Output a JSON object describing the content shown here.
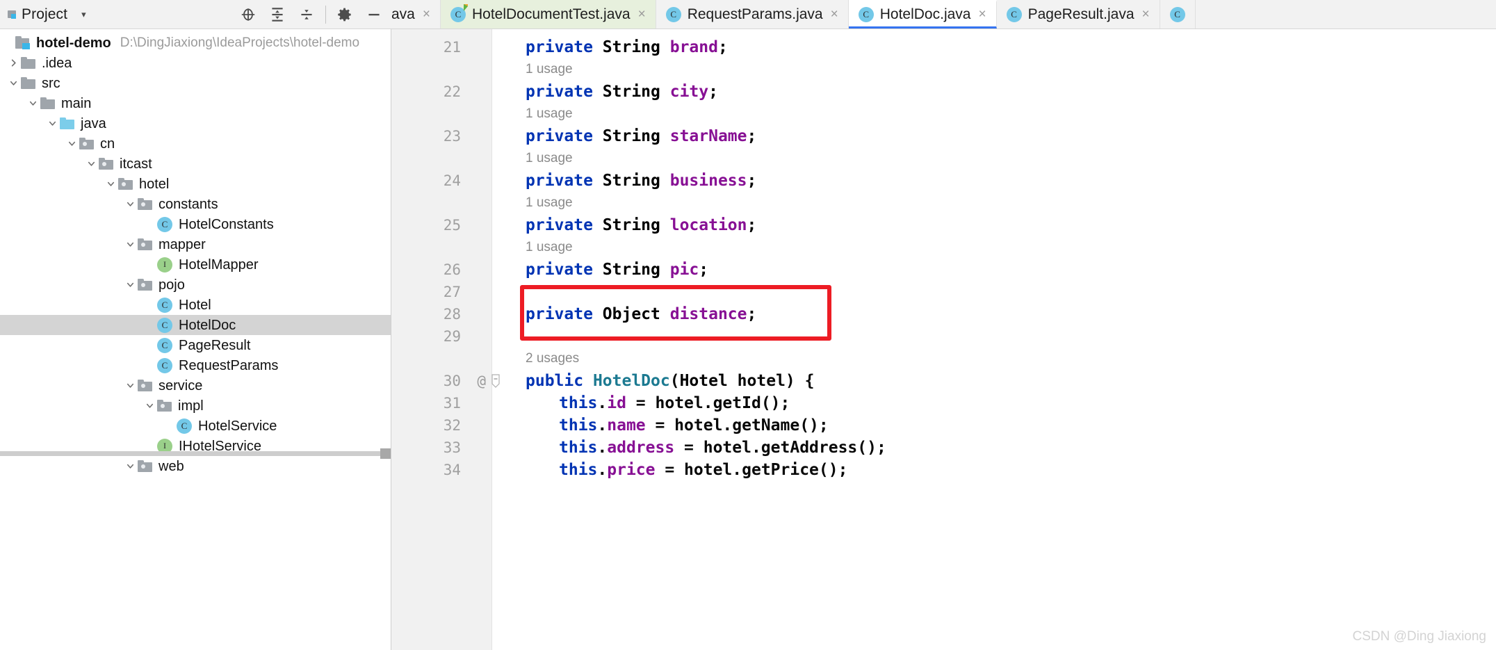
{
  "toolwindow": {
    "title": "Project",
    "dropdown_caret": "▾",
    "icons": [
      {
        "name": "locate-icon",
        "glyph": "locate"
      },
      {
        "name": "expand-all-icon",
        "glyph": "expand-all"
      },
      {
        "name": "collapse-all-icon",
        "glyph": "collapse-all"
      },
      {
        "name": "gear-icon",
        "glyph": "gear"
      },
      {
        "name": "minimize-icon",
        "glyph": "minus"
      }
    ]
  },
  "tabs": [
    {
      "label": "ava",
      "icon": "",
      "state": "clipped",
      "close": "×"
    },
    {
      "label": "HotelDocumentTest.java",
      "icon": "class-test-icon",
      "state": "green",
      "close": "×"
    },
    {
      "label": "RequestParams.java",
      "icon": "class-icon",
      "state": "normal",
      "close": "×"
    },
    {
      "label": "HotelDoc.java",
      "icon": "class-icon",
      "state": "active",
      "close": "×"
    },
    {
      "label": "PageResult.java",
      "icon": "class-icon",
      "state": "normal",
      "close": "×"
    },
    {
      "label": "",
      "icon": "class-icon",
      "state": "edge",
      "close": ""
    }
  ],
  "tree": {
    "root": {
      "label": "hotel-demo",
      "path": "D:\\DingJiaxiong\\IdeaProjects\\hotel-demo",
      "icon": "project-folder-icon"
    },
    "items": [
      {
        "label": ".idea",
        "depth": 1,
        "icon": "folder-icon",
        "twisty": "collapsed",
        "selected": false
      },
      {
        "label": "src",
        "depth": 1,
        "icon": "folder-icon",
        "twisty": "expanded",
        "selected": false
      },
      {
        "label": "main",
        "depth": 2,
        "icon": "folder-icon",
        "twisty": "expanded",
        "selected": false
      },
      {
        "label": "java",
        "depth": 3,
        "icon": "source-root-icon",
        "twisty": "expanded",
        "selected": false
      },
      {
        "label": "cn",
        "depth": 4,
        "icon": "package-icon",
        "twisty": "expanded",
        "selected": false
      },
      {
        "label": "itcast",
        "depth": 5,
        "icon": "package-icon",
        "twisty": "expanded",
        "selected": false
      },
      {
        "label": "hotel",
        "depth": 6,
        "icon": "package-icon",
        "twisty": "expanded",
        "selected": false
      },
      {
        "label": "constants",
        "depth": 7,
        "icon": "package-icon",
        "twisty": "expanded",
        "selected": false
      },
      {
        "label": "HotelConstants",
        "depth": 8,
        "icon": "class-icon",
        "twisty": "none",
        "selected": false
      },
      {
        "label": "mapper",
        "depth": 7,
        "icon": "package-icon",
        "twisty": "expanded",
        "selected": false
      },
      {
        "label": "HotelMapper",
        "depth": 8,
        "icon": "interface-icon",
        "twisty": "none",
        "selected": false
      },
      {
        "label": "pojo",
        "depth": 7,
        "icon": "package-icon",
        "twisty": "expanded",
        "selected": false
      },
      {
        "label": "Hotel",
        "depth": 8,
        "icon": "class-icon",
        "twisty": "none",
        "selected": false
      },
      {
        "label": "HotelDoc",
        "depth": 8,
        "icon": "class-icon",
        "twisty": "none",
        "selected": true
      },
      {
        "label": "PageResult",
        "depth": 8,
        "icon": "class-icon",
        "twisty": "none",
        "selected": false
      },
      {
        "label": "RequestParams",
        "depth": 8,
        "icon": "class-icon",
        "twisty": "none",
        "selected": false
      },
      {
        "label": "service",
        "depth": 7,
        "icon": "package-icon",
        "twisty": "expanded",
        "selected": false
      },
      {
        "label": "impl",
        "depth": 8,
        "icon": "package-icon",
        "twisty": "expanded",
        "selected": false
      },
      {
        "label": "HotelService",
        "depth": 9,
        "icon": "class-icon",
        "twisty": "none",
        "selected": false
      },
      {
        "label": "IHotelService",
        "depth": 8,
        "icon": "interface-icon",
        "twisty": "none",
        "selected": false
      },
      {
        "label": "web",
        "depth": 7,
        "icon": "package-icon",
        "twisty": "expanded",
        "selected": false
      }
    ]
  },
  "editor": {
    "rows": [
      {
        "kind": "code",
        "number": "21",
        "indent": 1,
        "tokens": [
          {
            "t": "private ",
            "c": "kw"
          },
          {
            "t": "String ",
            "c": "typ"
          },
          {
            "t": "brand",
            "c": "fld"
          },
          {
            "t": ";",
            "c": "pln"
          }
        ]
      },
      {
        "kind": "hint",
        "text": "1 usage",
        "indent": 1
      },
      {
        "kind": "code",
        "number": "22",
        "indent": 1,
        "tokens": [
          {
            "t": "private ",
            "c": "kw"
          },
          {
            "t": "String ",
            "c": "typ"
          },
          {
            "t": "city",
            "c": "fld"
          },
          {
            "t": ";",
            "c": "pln"
          }
        ]
      },
      {
        "kind": "hint",
        "text": "1 usage",
        "indent": 1
      },
      {
        "kind": "code",
        "number": "23",
        "indent": 1,
        "tokens": [
          {
            "t": "private ",
            "c": "kw"
          },
          {
            "t": "String ",
            "c": "typ"
          },
          {
            "t": "starName",
            "c": "fld"
          },
          {
            "t": ";",
            "c": "pln"
          }
        ]
      },
      {
        "kind": "hint",
        "text": "1 usage",
        "indent": 1
      },
      {
        "kind": "code",
        "number": "24",
        "indent": 1,
        "tokens": [
          {
            "t": "private ",
            "c": "kw"
          },
          {
            "t": "String ",
            "c": "typ"
          },
          {
            "t": "business",
            "c": "fld"
          },
          {
            "t": ";",
            "c": "pln"
          }
        ]
      },
      {
        "kind": "hint",
        "text": "1 usage",
        "indent": 1
      },
      {
        "kind": "code",
        "number": "25",
        "indent": 1,
        "tokens": [
          {
            "t": "private ",
            "c": "kw"
          },
          {
            "t": "String ",
            "c": "typ"
          },
          {
            "t": "location",
            "c": "fld"
          },
          {
            "t": ";",
            "c": "pln"
          }
        ]
      },
      {
        "kind": "hint",
        "text": "1 usage",
        "indent": 1
      },
      {
        "kind": "code",
        "number": "26",
        "indent": 1,
        "tokens": [
          {
            "t": "private ",
            "c": "kw"
          },
          {
            "t": "String ",
            "c": "typ"
          },
          {
            "t": "pic",
            "c": "fld"
          },
          {
            "t": ";",
            "c": "pln"
          }
        ]
      },
      {
        "kind": "code",
        "number": "27",
        "indent": 1,
        "tokens": []
      },
      {
        "kind": "code",
        "number": "28",
        "indent": 1,
        "tokens": [
          {
            "t": "private ",
            "c": "kw"
          },
          {
            "t": "Object ",
            "c": "typ"
          },
          {
            "t": "distance",
            "c": "fld"
          },
          {
            "t": ";",
            "c": "pln"
          }
        ]
      },
      {
        "kind": "code",
        "number": "29",
        "indent": 1,
        "tokens": []
      },
      {
        "kind": "hint",
        "text": "2 usages",
        "indent": 1
      },
      {
        "kind": "code",
        "number": "30",
        "indent": 1,
        "marker": "@",
        "fold": true,
        "tokens": [
          {
            "t": "public ",
            "c": "kw"
          },
          {
            "t": "HotelDoc",
            "c": "cls"
          },
          {
            "t": "(",
            "c": "pln"
          },
          {
            "t": "Hotel",
            "c": "typ"
          },
          {
            "t": " hotel) {",
            "c": "pln"
          }
        ]
      },
      {
        "kind": "code",
        "number": "31",
        "indent": 2,
        "tokens": [
          {
            "t": "this",
            "c": "kw"
          },
          {
            "t": ".",
            "c": "pln"
          },
          {
            "t": "id",
            "c": "fld"
          },
          {
            "t": " = hotel.getId();",
            "c": "pln"
          }
        ]
      },
      {
        "kind": "code",
        "number": "32",
        "indent": 2,
        "tokens": [
          {
            "t": "this",
            "c": "kw"
          },
          {
            "t": ".",
            "c": "pln"
          },
          {
            "t": "name",
            "c": "fld"
          },
          {
            "t": " = hotel.getName();",
            "c": "pln"
          }
        ]
      },
      {
        "kind": "code",
        "number": "33",
        "indent": 2,
        "tokens": [
          {
            "t": "this",
            "c": "kw"
          },
          {
            "t": ".",
            "c": "pln"
          },
          {
            "t": "address",
            "c": "fld"
          },
          {
            "t": " = hotel.getAddress();",
            "c": "pln"
          }
        ]
      },
      {
        "kind": "code",
        "number": "34",
        "indent": 2,
        "tokens": [
          {
            "t": "this",
            "c": "kw"
          },
          {
            "t": ".",
            "c": "pln"
          },
          {
            "t": "price",
            "c": "fld"
          },
          {
            "t": " = hotel.getPrice();",
            "c": "pln"
          }
        ]
      }
    ],
    "annotation": {
      "name": "distance-field-highlight",
      "color": "#ed1c24"
    }
  },
  "watermark": {
    "text": "CSDN @Ding Jiaxiong"
  }
}
